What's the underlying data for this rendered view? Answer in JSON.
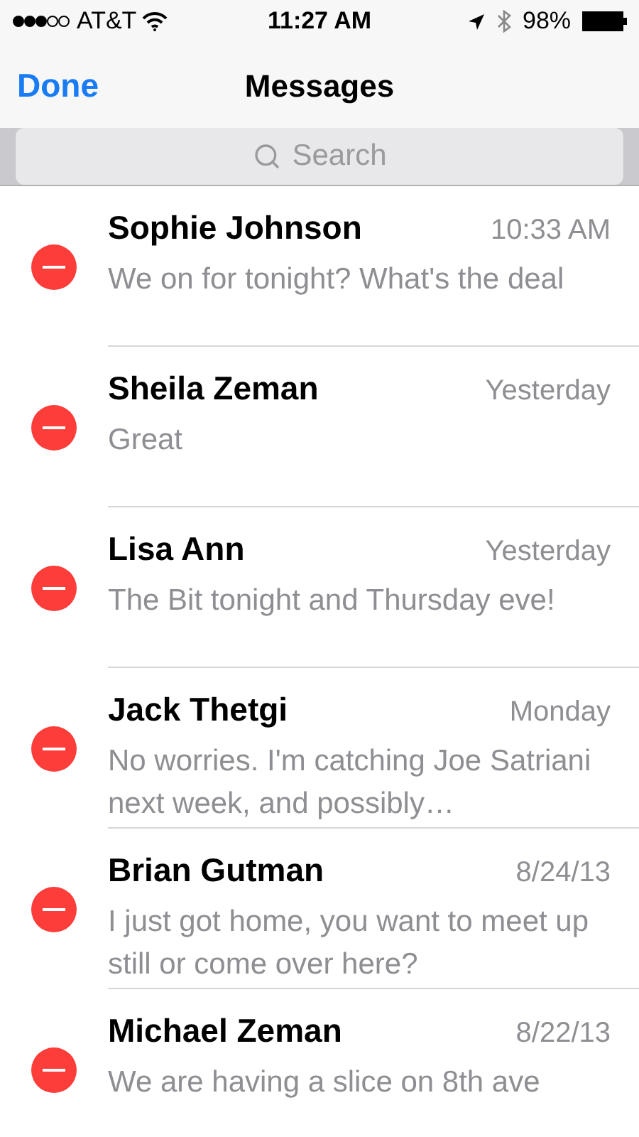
{
  "status_bar": {
    "carrier": "AT&T",
    "time": "11:27 AM",
    "battery": "98%"
  },
  "nav": {
    "done": "Done",
    "title": "Messages"
  },
  "search": {
    "placeholder": "Search"
  },
  "conversations": [
    {
      "name": "Sophie Johnson",
      "time": "10:33 AM",
      "preview": "We on for tonight? What's the deal"
    },
    {
      "name": "Sheila Zeman",
      "time": "Yesterday",
      "preview": "Great"
    },
    {
      "name": "Lisa Ann",
      "time": "Yesterday",
      "preview": "The Bit tonight and Thursday eve!"
    },
    {
      "name": "Jack Thetgi",
      "time": "Monday",
      "preview": "No worries. I'm catching Joe Satriani next week, and possibly…"
    },
    {
      "name": "Brian Gutman",
      "time": "8/24/13",
      "preview": "I just got home, you want to meet up still or come over here?"
    },
    {
      "name": "Michael Zeman",
      "time": "8/22/13",
      "preview": "We are having a slice on 8th ave"
    }
  ]
}
